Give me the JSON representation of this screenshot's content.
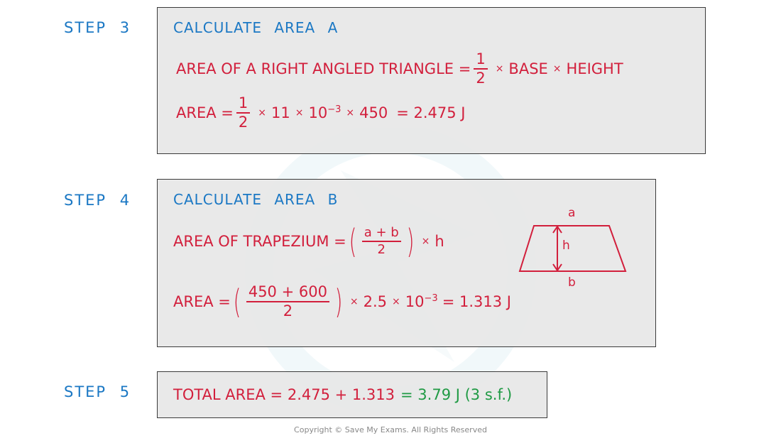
{
  "steps": [
    {
      "label": "STEP 3",
      "heading": "CALCULATE AREA A",
      "formula": {
        "lhs": "AREA OF A RIGHT ANGLED TRIANGLE =",
        "frac_num": "1",
        "frac_den": "2",
        "rhs_1": "BASE",
        "rhs_2": "HEIGHT",
        "times": "×"
      },
      "calc": {
        "lhs": "AREA =",
        "frac_num": "1",
        "frac_den": "2",
        "t1": "11",
        "t2_base": "10",
        "t2_exp": "−3",
        "t3": "450",
        "result": "= 2.475 J"
      }
    },
    {
      "label": "STEP 4",
      "heading": "CALCULATE AREA B",
      "formula": {
        "lhs": "AREA OF TRAPEZIUM =",
        "frac_num": "a + b",
        "frac_den": "2",
        "rhs": "h"
      },
      "calc": {
        "lhs": "AREA =",
        "frac_num": "450 + 600",
        "frac_den": "2",
        "t1": "2.5",
        "t2_base": "10",
        "t2_exp": "−3",
        "result": "= 1.313 J"
      },
      "diagram": {
        "top_label": "a",
        "bottom_label": "b",
        "height_label": "h"
      }
    },
    {
      "label": "STEP 5",
      "total": {
        "lhs": "TOTAL AREA = 2.475 + 1.313",
        "result": "= 3.79 J (3 s.f.)"
      }
    }
  ],
  "copyright": "Copyright © Save My Exams. All Rights Reserved",
  "colors": {
    "heading": "#1b78c4",
    "working": "#d21f3c",
    "answer": "#1f9a44"
  }
}
